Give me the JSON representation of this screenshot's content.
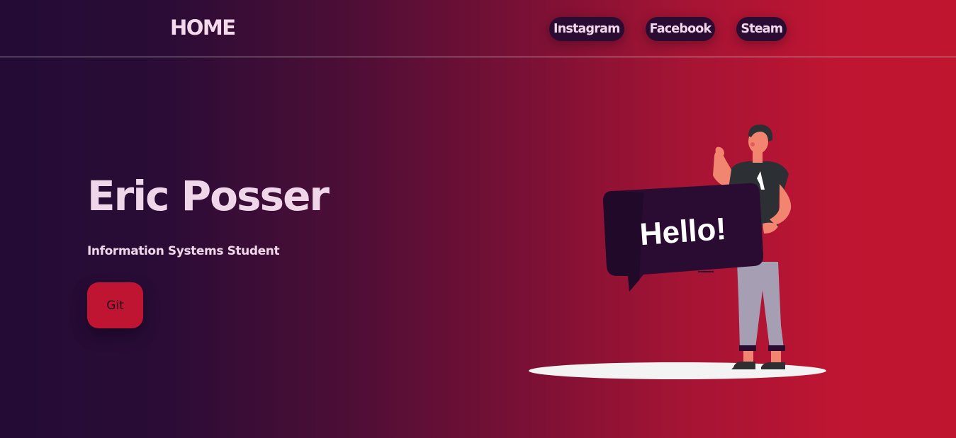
{
  "header": {
    "brand": "HOME",
    "nav": [
      {
        "label": "Instagram"
      },
      {
        "label": "Facebook"
      },
      {
        "label": "Steam"
      }
    ]
  },
  "hero": {
    "title": "Eric Posser",
    "subtitle": "Information Systems Student",
    "button_label": "Git",
    "illustration_text": "Hello!"
  },
  "colors": {
    "gradient_start": "#230b35",
    "gradient_end": "#c0152f",
    "accent": "#bf1532",
    "nav_pill": "#2a0c33",
    "text": "#efd6e8"
  }
}
